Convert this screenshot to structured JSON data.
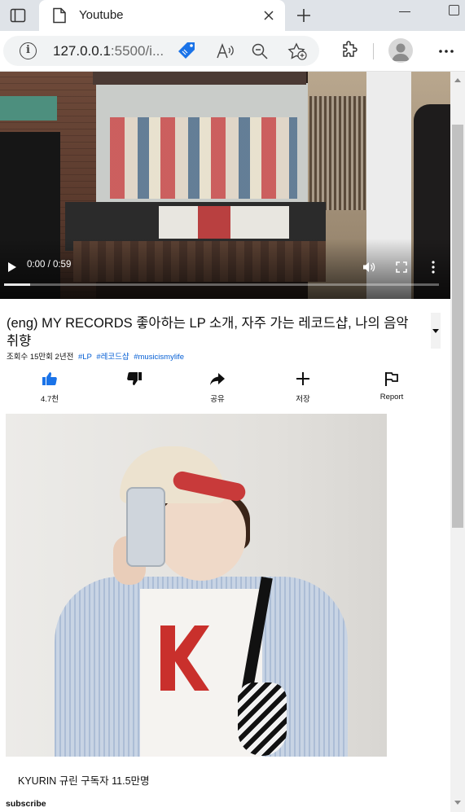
{
  "browser": {
    "tab_title": "Youtube",
    "url_host": "127.0.0.1",
    "url_rest": ":5500/i..."
  },
  "video": {
    "time": "0:00 / 0:59",
    "progress": 0.06
  },
  "details": {
    "title": "(eng) MY RECORDS 좋아하는 LP 소개, 자주 가는 레코드샵, 나의 음악 취향",
    "views": "조회수 15만회 2년전",
    "hashtags": [
      "#LP",
      "#레코드샵",
      "#musicismylife"
    ]
  },
  "actions": {
    "like": "4.7천",
    "dislike": "",
    "share": "공유",
    "save": "저장",
    "report": "Report"
  },
  "channel": {
    "name_line": "KYURIN 규린 구독자 11.5만명",
    "subscribe": "subscribe"
  },
  "colors": {
    "link": "#065fd4",
    "tabbar": "#dfe3e8",
    "omnibox": "#f1f3f4"
  }
}
